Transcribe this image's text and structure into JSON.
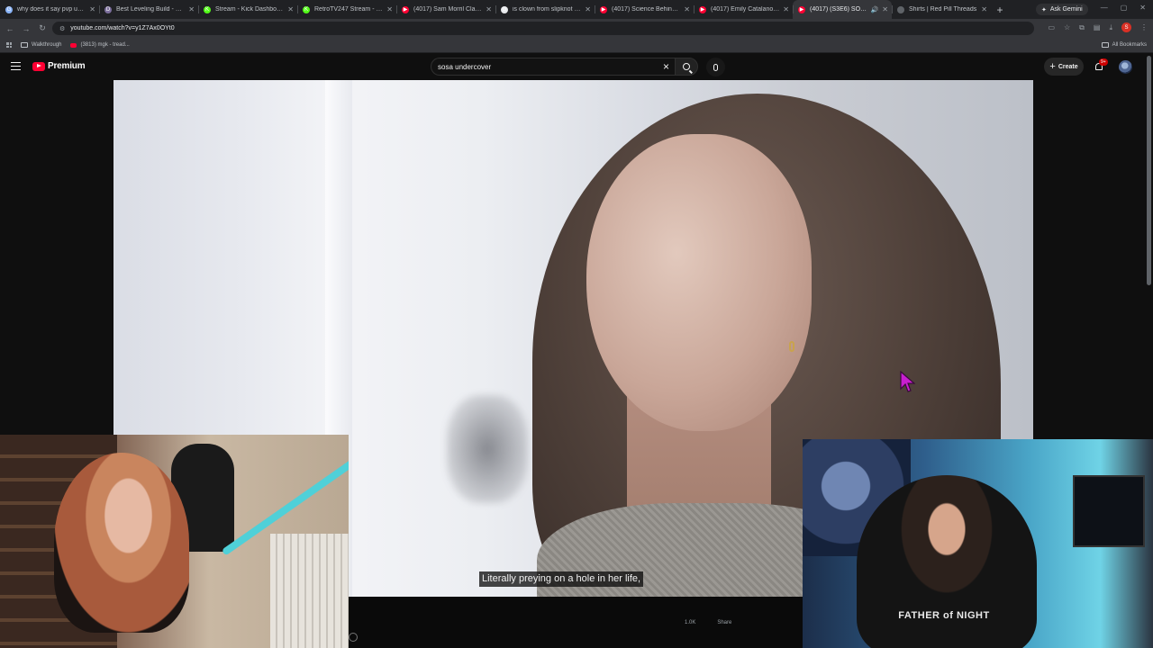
{
  "browser": {
    "tabs": [
      {
        "title": "why does it say pvp unavail",
        "favicon_color": "#8ab4f8",
        "favicon_glyph": "G",
        "active": false
      },
      {
        "title": "Best Leveling Build - Diablo",
        "favicon_color": "#7c6f9c",
        "favicon_glyph": "D",
        "active": false
      },
      {
        "title": "Stream - Kick Dashboard",
        "favicon_color": "#53fc18",
        "favicon_glyph": "K",
        "active": false
      },
      {
        "title": "RetroTV247 Stream - Watch",
        "favicon_color": "#53fc18",
        "favicon_glyph": "K",
        "active": false
      },
      {
        "title": "(4017) Sam Morril Class Act",
        "favicon_color": "#ff0033",
        "favicon_glyph": "▶",
        "active": false
      },
      {
        "title": "is clown from slipknot a veg",
        "favicon_color": "#e8eaed",
        "favicon_glyph": "G",
        "active": false
      },
      {
        "title": "(4017) Science Behind Time",
        "favicon_color": "#ff0033",
        "favicon_glyph": "▶",
        "active": false
      },
      {
        "title": "(4017) Emily Catalano - Ulti",
        "favicon_color": "#ff0033",
        "favicon_glyph": "▶",
        "active": false
      },
      {
        "title": "(4017) (S3E6) SOSA Inv",
        "favicon_color": "#ff0033",
        "favicon_glyph": "▶",
        "active": true,
        "audio": true
      },
      {
        "title": "Shirts | Red Pill Threads",
        "favicon_color": "#5f6368",
        "favicon_glyph": "",
        "active": false
      }
    ],
    "new_tab_label": "+",
    "ask_gemini_label": "Ask Gemini",
    "url": "youtube.com/watch?v=y1Z7Ax0OYt0",
    "profile_initial": "S",
    "bookmarks": [
      {
        "label": "Walkthrough",
        "icon": "folder-icon"
      },
      {
        "label": "(3813) mgk - tread...",
        "icon": "youtube-icon"
      }
    ],
    "all_bookmarks_label": "All Bookmarks"
  },
  "youtube": {
    "brand": "Premium",
    "search_query": "sosa undercover",
    "create_label": "Create",
    "notification_badge": "9+",
    "subtitle": "Literally preying on a hole in her life,",
    "player_controls": [
      "1.0K",
      "",
      "Share"
    ],
    "shirt_text": "FATHER of NIGHT"
  },
  "colors": {
    "youtube_red": "#ff0033",
    "background": "#0f0f0f",
    "cursor": "#c81fcf"
  }
}
